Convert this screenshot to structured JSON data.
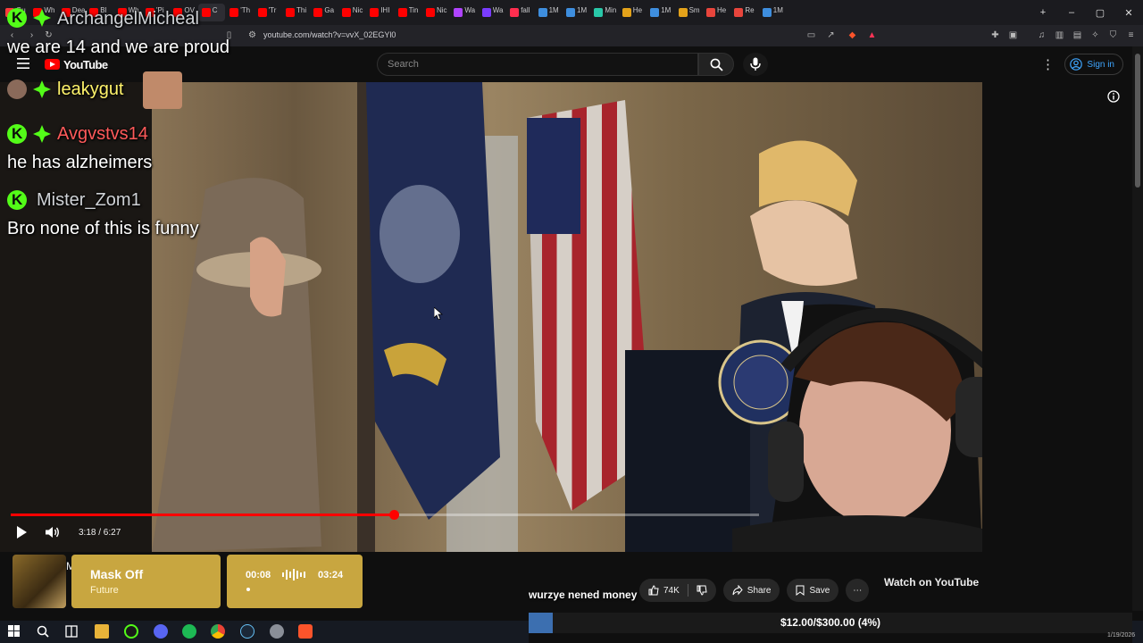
{
  "browser": {
    "tabs": [
      {
        "label": "Gu",
        "fav_color": "#ff3b3b"
      },
      {
        "label": "Wh",
        "fav_color": "#ff0000"
      },
      {
        "label": "Dea",
        "fav_color": "#ff0000"
      },
      {
        "label": "Bl",
        "fav_color": "#ff0000"
      },
      {
        "label": "Wh",
        "fav_color": "#ff0000"
      },
      {
        "label": "'Pi",
        "fav_color": "#ff0000"
      },
      {
        "label": "OV",
        "fav_color": "#ff0000"
      },
      {
        "label": "C",
        "fav_color": "#ff0000"
      },
      {
        "label": "'Th",
        "fav_color": "#ff0000"
      },
      {
        "label": "'Tr",
        "fav_color": "#ff0000"
      },
      {
        "label": "Thi",
        "fav_color": "#ff0000"
      },
      {
        "label": "Ga",
        "fav_color": "#ff0000"
      },
      {
        "label": "Nic",
        "fav_color": "#ff0000"
      },
      {
        "label": "IHI",
        "fav_color": "#ff0000"
      },
      {
        "label": "Tin",
        "fav_color": "#ff0000"
      },
      {
        "label": "Nic",
        "fav_color": "#ff0000"
      },
      {
        "label": "Wa",
        "fav_color": "#b044ff"
      },
      {
        "label": "Wa",
        "fav_color": "#7a3cff"
      },
      {
        "label": "fall",
        "fav_color": "#ff2e4f"
      },
      {
        "label": "1M",
        "fav_color": "#3e8ede"
      },
      {
        "label": "1M",
        "fav_color": "#3e8ede"
      },
      {
        "label": "Min",
        "fav_color": "#29c7a8"
      },
      {
        "label": "He",
        "fav_color": "#e3a21a"
      },
      {
        "label": "1M",
        "fav_color": "#3e8ede"
      },
      {
        "label": "Sm",
        "fav_color": "#e3a21a"
      },
      {
        "label": "He",
        "fav_color": "#e8453c"
      },
      {
        "label": "Re",
        "fav_color": "#e8453c"
      },
      {
        "label": "1M",
        "fav_color": "#3e8ede"
      }
    ],
    "url": "youtube.com/watch?v=vvX_02EGYl0"
  },
  "youtube": {
    "logo_text": "YouTube",
    "search_placeholder": "Search",
    "sign_in_label": "Sign in",
    "time_display": "3:18 / 6:27",
    "progress": 0.512,
    "likes": "74K",
    "share_label": "Share",
    "save_label": "Save",
    "watch_on": "Watch on YouTube"
  },
  "chat": [
    {
      "user": "ArchangelMicheal",
      "user_color": "#cfd2d6",
      "badges": [
        "kick",
        "gift"
      ],
      "text": "we are 14 and we are proud"
    },
    {
      "user": "leakygut",
      "user_color": "#fff36b",
      "badges": [
        "avatar",
        "gift"
      ],
      "text": ""
    },
    {
      "user": "Avgvstvs14",
      "user_color": "#ff5a5a",
      "badges": [
        "kick",
        "gift"
      ],
      "text": "he has alzheimers"
    },
    {
      "user": "Mister_Zom1",
      "user_color": "#cfd2d6",
      "badges": [
        "kick"
      ],
      "text": "Bro none of this is funny"
    }
  ],
  "music": {
    "title": "Mask Off",
    "artist": "Future",
    "current": "00:08",
    "duration": "03:24"
  },
  "tts_name": "wurzye nened money",
  "goal": {
    "text": "$12.00/$300.00 (4%)",
    "fraction": 0.04
  },
  "clock": "1/19/2026"
}
